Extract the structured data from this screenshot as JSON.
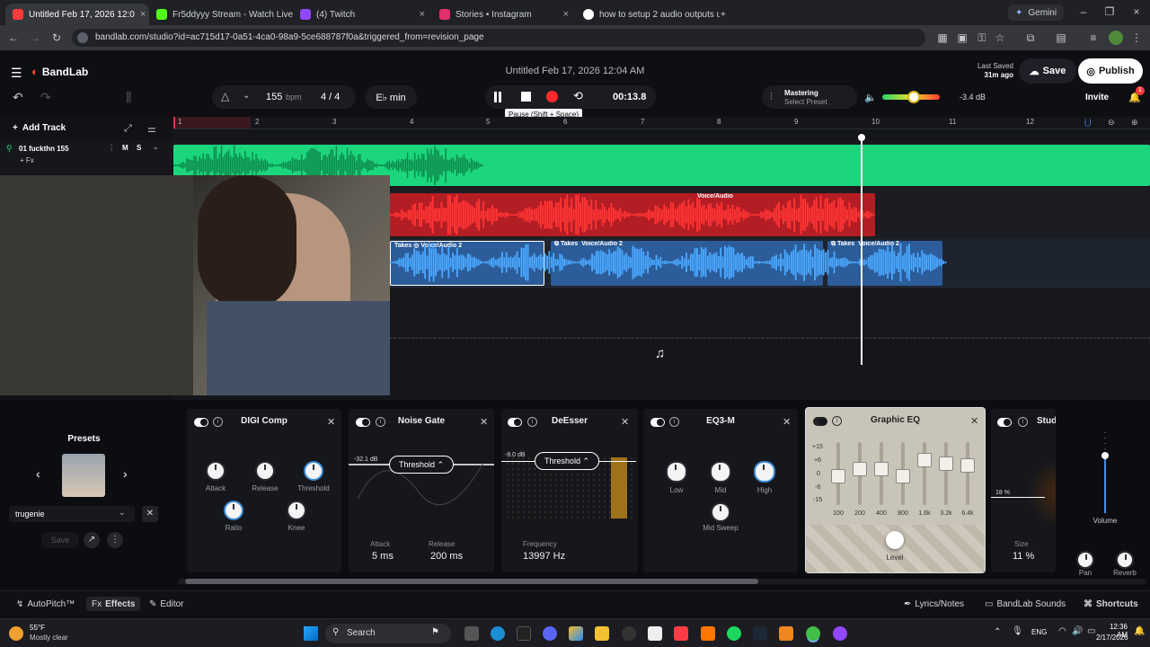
{
  "browser": {
    "tabs": [
      {
        "title": "Untitled Feb 17, 2026 12:0",
        "active": true,
        "color": "#ff3b3b"
      },
      {
        "title": "Fr5ddyyy Stream - Watch Live c",
        "color": "#53fc18"
      },
      {
        "title": "(4) Twitch",
        "color": "#9146ff"
      },
      {
        "title": "Stories • Instagram",
        "color": "#e1306c"
      },
      {
        "title": "how to setup 2 audio outputs u",
        "color": "#ffffff"
      }
    ],
    "gemini_label": "Gemini",
    "url": "bandlab.com/studio?id=ac715d17-0a51-4ca0-98a9-5ce688787f0a&triggered_from=revision_page"
  },
  "header": {
    "brand": "BandLab",
    "project_title": "Untitled Feb 17, 2026 12:04 AM",
    "last_saved_label": "Last Saved",
    "last_saved_value": "31m ago",
    "save_label": "Save",
    "publish_label": "Publish",
    "bpm": "155",
    "bpm_unit": "bpm",
    "time_sig": "4 / 4",
    "key": "E♭ min",
    "time": "00:13.8",
    "mastering_label": "Mastering",
    "mastering_preset": "Select Preset",
    "volume_db": "-3.4 dB",
    "invite_label": "Invite",
    "notif_count": "1",
    "tooltip": "Pause (Shift + Space)"
  },
  "tracks": {
    "add_track_label": "Add Track",
    "track1_name": "01  fuckthn 155",
    "track1_fx": "+ Fx",
    "ruler": [
      "1",
      "2",
      "3",
      "4",
      "5",
      "6",
      "7",
      "8",
      "9",
      "10",
      "11",
      "12"
    ],
    "clips": [
      {
        "label": "Voice/Audio"
      },
      {
        "label": "Voice/Audio 2",
        "takes": "Takes"
      },
      {
        "label": "Voice/Audio 2",
        "takes": "Takes"
      },
      {
        "label": "Voice/Audio 2",
        "takes": "Takes"
      }
    ]
  },
  "rack": {
    "presets_label": "Presets",
    "preset_name": "trugenie",
    "save_label": "Save",
    "effects": [
      {
        "title": "DIGI Comp",
        "knobs": [
          "Attack",
          "Release",
          "Threshold",
          "Ratio",
          "Knee"
        ]
      },
      {
        "title": "Noise Gate",
        "threshold_label": "Threshold",
        "db_label": "-32.1 dB",
        "attack_label": "Attack",
        "attack_value": "5 ms",
        "release_label": "Release",
        "release_value": "200 ms"
      },
      {
        "title": "DeEsser",
        "threshold_label": "Threshold",
        "db_label": "-8.0 dB",
        "freq_label": "Frequency",
        "freq_value": "13997 Hz"
      },
      {
        "title": "EQ3-M",
        "knobs": [
          "Low",
          "Mid",
          "High",
          "Mid Sweep"
        ]
      },
      {
        "title": "Graphic EQ",
        "scale": [
          "+15",
          "+6",
          "0",
          "-6",
          "-15"
        ],
        "bands": [
          "100",
          "200",
          "400",
          "800",
          "1.6k",
          "3.2k",
          "6.4k"
        ],
        "level_label": "Level"
      },
      {
        "title": "Stud",
        "size_label": "Size",
        "size_value": "11 %",
        "pct_label": "18 %"
      }
    ],
    "volume_label": "Volume",
    "pan_label": "Pan",
    "reverb_label": "Reverb"
  },
  "bottom": {
    "autopitch": "AutoPitch™",
    "effects": "Effects",
    "editor": "Editor",
    "lyrics": "Lyrics/Notes",
    "sounds": "BandLab Sounds",
    "shortcuts": "Shortcuts"
  },
  "taskbar": {
    "weather_temp": "55°F",
    "weather_desc": "Mostly clear",
    "search_label": "Search",
    "lang": "ENG",
    "time": "12:36 AM",
    "date": "2/17/2026"
  }
}
